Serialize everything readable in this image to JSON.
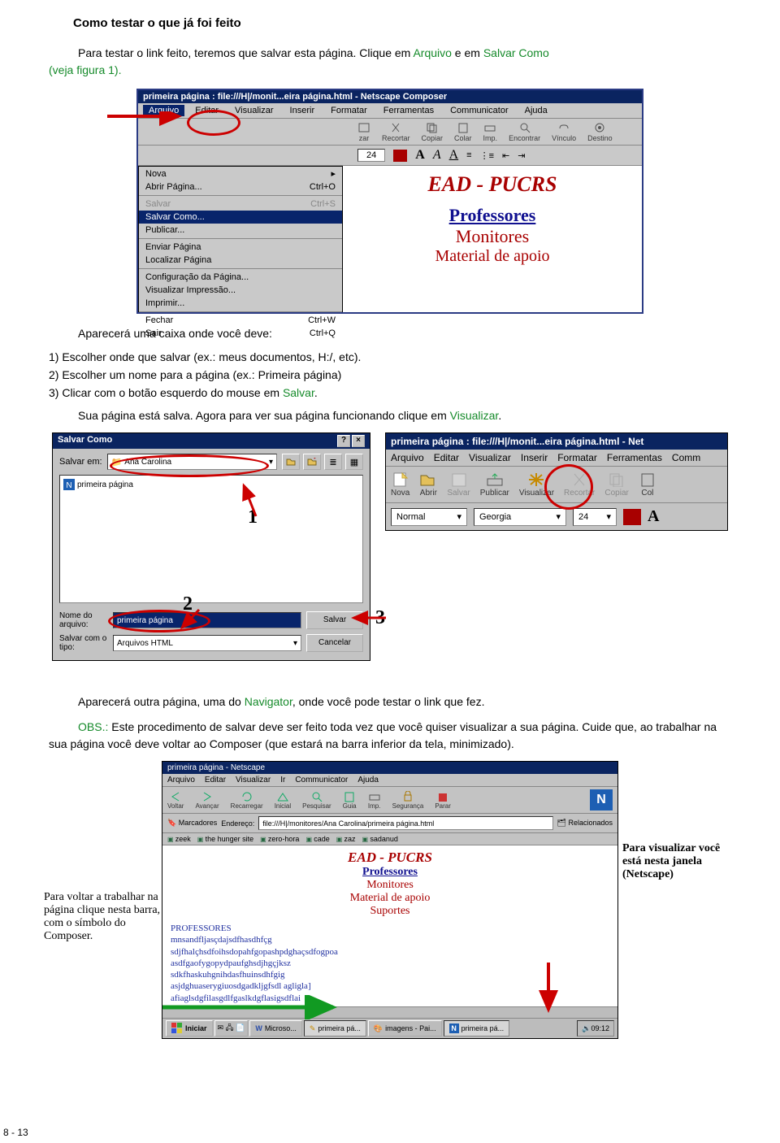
{
  "title": "Como testar o que já foi feito",
  "intro1a": "Para testar o link feito, teremos que salvar esta página. Clique em ",
  "intro_arq": "Arquivo",
  "intro1b": " e em ",
  "intro_sal": "Salvar Como",
  "intro2": " (veja figura 1).",
  "fig1": {
    "title": "primeira página : file:///H|/monit...eira página.html - Netscape Composer",
    "menus": [
      "Arquivo",
      "Editar",
      "Visualizar",
      "Inserir",
      "Formatar",
      "Ferramentas",
      "Communicator",
      "Ajuda"
    ],
    "tool": [
      "zar",
      "Recortar",
      "Copiar",
      "Colar",
      "Imp.",
      "Encontrar",
      "Vínculo",
      "Destino"
    ],
    "fmt_num": "24",
    "dropdown": [
      {
        "l": "Nova",
        "r": "▸"
      },
      {
        "l": "Abrir Página...",
        "r": "Ctrl+O"
      },
      {
        "sep": true
      },
      {
        "l": "Salvar",
        "r": "Ctrl+S",
        "dis": true
      },
      {
        "l": "Salvar Como...",
        "sel": true
      },
      {
        "l": "Publicar..."
      },
      {
        "sep": true
      },
      {
        "l": "Enviar Página"
      },
      {
        "l": "Localizar Página"
      },
      {
        "sep": true
      },
      {
        "l": "Configuração da Página..."
      },
      {
        "l": "Visualizar Impressão..."
      },
      {
        "l": "Imprimir..."
      },
      {
        "sep": true
      },
      {
        "l": "Fechar",
        "r": "Ctrl+W"
      },
      {
        "l": "Sair",
        "r": "Ctrl+Q"
      }
    ],
    "ead": "EAD - PUCRS",
    "prof": "Professores",
    "mon": "Monitores",
    "mat": "Material de apoio"
  },
  "aparece": "Aparecerá uma caixa onde você deve:",
  "li1a": "1)   Escolher onde que salvar (ex.: meus documentos, H:/, etc).",
  "li2a": "2)   Escolher um nome para a página (ex.: Primeira página)",
  "li3a": "3)   Clicar com o botão esquerdo do mouse em ",
  "li3b": "Salvar",
  "li3c": ".",
  "sua_a": "Sua página está salva. Agora para ver sua página funcionando clique em ",
  "visual": "Visualizar",
  "sua_b": ".",
  "sav": {
    "title": "Salvar Como",
    "salvar_em": "Salvar em:",
    "folder": "Ana Carolina",
    "file_icon": "primeira página",
    "nome_lbl": "Nome do arquivo:",
    "nome_val": "primeira página",
    "tipo_lbl": "Salvar com o tipo:",
    "tipo_val": "Arquivos HTML",
    "btn_salvar": "Salvar",
    "btn_cancelar": "Cancelar",
    "n1": "1",
    "n2": "2"
  },
  "n3": "3",
  "comp2": {
    "title": "primeira página : file:///H|/monit...eira página.html - Net",
    "menus": [
      "Arquivo",
      "Editar",
      "Visualizar",
      "Inserir",
      "Formatar",
      "Ferramentas",
      "Comm"
    ],
    "tool": [
      "Nova",
      "Abrir",
      "Salvar",
      "Publicar",
      "Visualizar",
      "Recortar",
      "Copiar",
      "Col"
    ],
    "fmt1": "Normal",
    "fmt2": "Georgia",
    "fmt3": "24"
  },
  "para2a": "Aparecerá outra página, uma do ",
  "navigator": "Navigator",
  "para2b": ", onde você pode testar o link que fez.",
  "obs_lbl": "OBS.: ",
  "obs_body": "Este procedimento de salvar deve ser feito toda vez que você quiser visualizar a sua página. Cuide que, ao trabalhar na sua página você deve voltar ao Composer (que estará na barra inferior da tela, minimizado).",
  "nav": {
    "title": "primeira página - Netscape",
    "menus": [
      "Arquivo",
      "Editar",
      "Visualizar",
      "Ir",
      "Communicator",
      "Ajuda"
    ],
    "tool": [
      "Voltar",
      "Avançar",
      "Recarregar",
      "Inicial",
      "Pesquisar",
      "Guia",
      "Imp.",
      "Segurança",
      "Parar"
    ],
    "marc": "Marcadores",
    "endereco": "Endereço:",
    "url": "file:///H|/monitores/Ana Carolina/primeira página.html",
    "rel": "Relacionados",
    "bm": [
      "zeek",
      "the hunger site",
      "zero-hora",
      "cade",
      "zaz",
      "sadanud"
    ],
    "ead": "EAD - PUCRS",
    "prof": "Professores",
    "mon": "Monitores",
    "mat": "Material de apoio",
    "sup": "Suportes",
    "ptitle": "PROFESSORES",
    "lines": [
      "mnsandfljasçdajsdfhasdhfçg",
      "sdjfhalçhsdfoihsdopahfgopashpdghaçsdfogpoa",
      "asdfgaofygopydpaufghsdjhgçjksz",
      "sdkfhaskuhgnihdasfhuinsdhfgig",
      "asjdghuaserygiuosdgadkljgfsdl agligla]",
      "afiaglsdgfilasgdlfgaslkdgflasigsdflai"
    ],
    "task_start": "Iniciar",
    "task_items": [
      "Microso...",
      "primeira pá...",
      "imagens - Pai...",
      "primeira pá..."
    ],
    "clock": "09:12"
  },
  "note_left": "Para voltar a trabalhar na página clique nesta barra, com o símbolo do Composer.",
  "note_right": "Para visualizar você está nesta janela (Netscape)",
  "page_num": "8 - 13"
}
